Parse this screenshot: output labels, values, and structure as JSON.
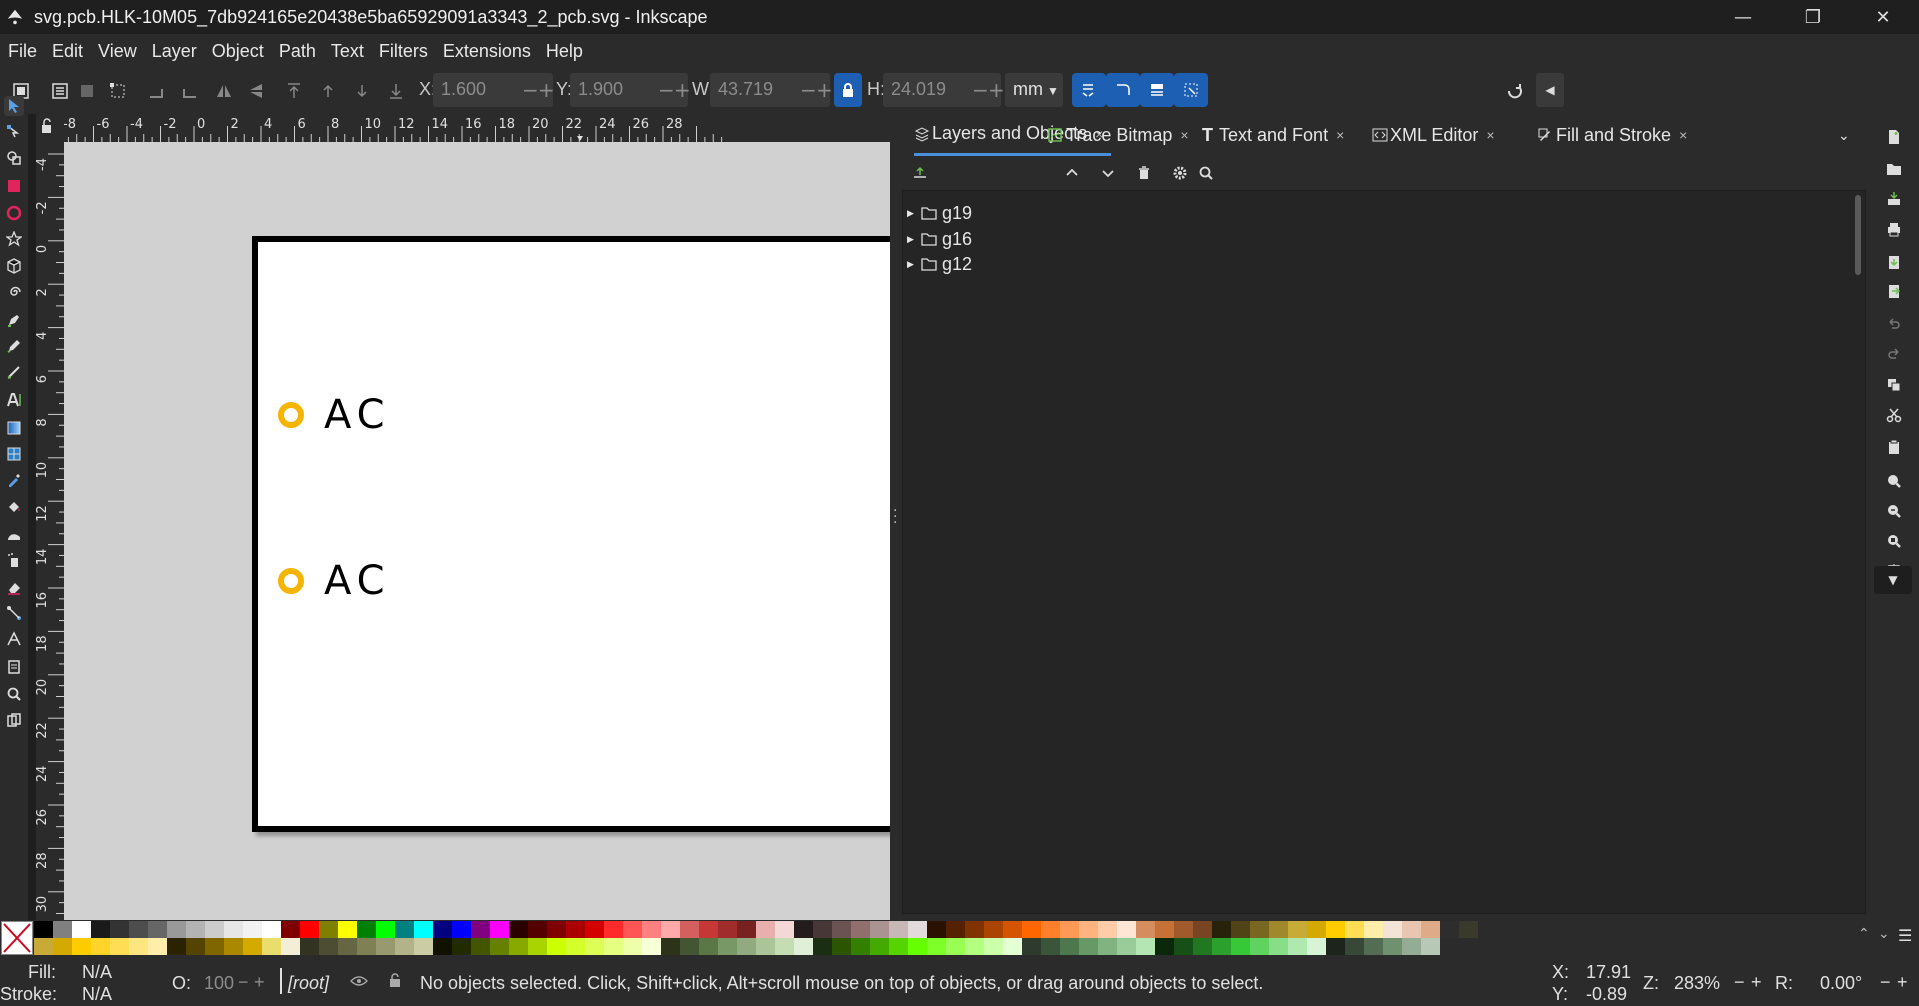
{
  "window": {
    "title": "svg.pcb.HLK-10M05_7db924165e20438e5ba65929091a3343_2_pcb.svg - Inkscape",
    "minimize_glyph": "—",
    "maximize_glyph": "❐",
    "close_glyph": "✕"
  },
  "menu": [
    "File",
    "Edit",
    "View",
    "Layer",
    "Object",
    "Path",
    "Text",
    "Filters",
    "Extensions",
    "Help"
  ],
  "toolbar": {
    "x_label": "X:",
    "x_value": "1.600",
    "y_label": "Y:",
    "y_value": "1.900",
    "w_label": "W:",
    "w_value": "43.719",
    "h_label": "H:",
    "h_value": "24.019",
    "unit": "mm",
    "minus": "−",
    "plus": "+"
  },
  "rulers": {
    "top": [
      "-8",
      "-6",
      "-4",
      "-2",
      "0",
      "2",
      "4",
      "6",
      "8",
      "10",
      "12",
      "14",
      "16",
      "18",
      "20",
      "22",
      "24",
      "26",
      "28"
    ],
    "left": [
      "-4",
      "-2",
      "0",
      "2",
      "4",
      "6",
      "8",
      "10",
      "12",
      "14",
      "16",
      "18",
      "20",
      "22",
      "24",
      "26",
      "28",
      "30"
    ]
  },
  "canvas": {
    "labels": [
      "AC",
      "AC"
    ],
    "accent_color": "#f5b400"
  },
  "dock": {
    "tabs": [
      {
        "label": "Layers and Objects",
        "icon": "layers-icon",
        "close": "×"
      },
      {
        "label": "Trace Bitmap",
        "icon": "trace-bitmap-icon",
        "close": "×"
      },
      {
        "label": "Text and Font",
        "icon": "text-icon",
        "close": "×"
      },
      {
        "label": "XML Editor",
        "icon": "xml-icon",
        "close": "×"
      },
      {
        "label": "Fill and Stroke",
        "icon": "fill-stroke-icon",
        "close": "×"
      }
    ],
    "layers": [
      "g19",
      "g16",
      "g12"
    ],
    "accent_color": "#4a90d9"
  },
  "status": {
    "fill_label": "Fill:",
    "fill_value": "N/A",
    "stroke_label": "Stroke:",
    "stroke_value": "N/A",
    "opacity_label": "O:",
    "opacity_value": "100",
    "layer": "[root]",
    "message": "No objects selected. Click, Shift+click, Alt+scroll mouse on top of objects, or drag around objects to select.",
    "cursor_x_label": "X:",
    "cursor_x": "17.91",
    "cursor_y_label": "Y:",
    "cursor_y": "-0.89",
    "zoom_label": "Z:",
    "zoom": "283%",
    "rotate_label": "R:",
    "rotate": "0.00°"
  }
}
